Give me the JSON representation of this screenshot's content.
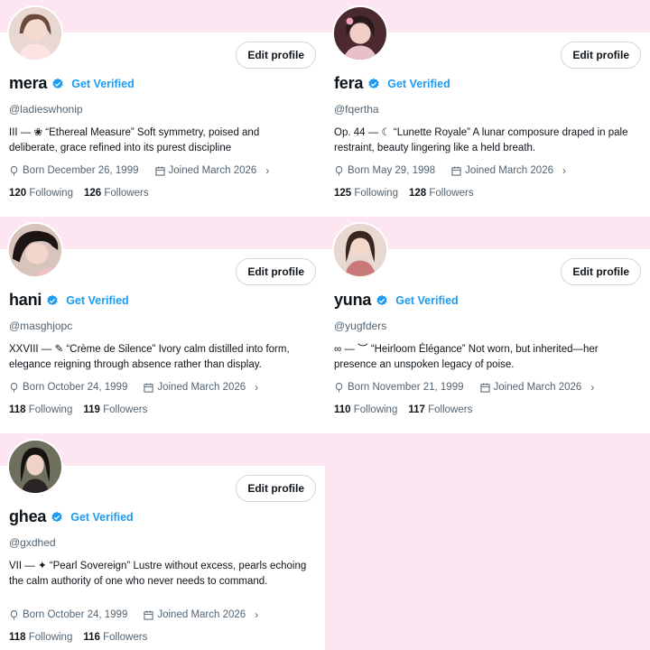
{
  "profiles": [
    {
      "name": "mera",
      "get_verified": "Get Verified",
      "handle": "@ladieswhonip",
      "bio": "III — ❀ “Ethereal Measure” Soft symmetry, poised and deliberate, grace refined into its purest discipline",
      "born": "Born December 26, 1999",
      "joined": "Joined March 2026",
      "following_count": "120",
      "following_label": "Following",
      "followers_count": "126",
      "followers_label": "Followers",
      "edit_label": "Edit profile"
    },
    {
      "name": "fera",
      "get_verified": "Get Verified",
      "handle": "@fqertha",
      "bio": "Op. 44 — ☾ “Lunette Royale” A lunar composure draped in pale restraint, beauty lingering like a held breath.",
      "born": "Born May 29, 1998",
      "joined": "Joined March 2026",
      "following_count": "125",
      "following_label": "Following",
      "followers_count": "128",
      "followers_label": "Followers",
      "edit_label": "Edit profile"
    },
    {
      "name": "hani",
      "get_verified": "Get Verified",
      "handle": "@masghjopc",
      "bio": "XXVIII — ✎ “Crème de Silence” Ivory calm distilled into form, elegance reigning through absence rather than display.",
      "born": "Born October 24, 1999",
      "joined": "Joined March 2026",
      "following_count": "118",
      "following_label": "Following",
      "followers_count": "119",
      "followers_label": "Followers",
      "edit_label": "Edit profile"
    },
    {
      "name": "yuna",
      "get_verified": "Get Verified",
      "handle": "@yugfders",
      "bio": "∞ — ︶ “Heirloom Élégance” Not worn, but inherited—her presence an unspoken legacy of poise.",
      "born": "Born November 21, 1999",
      "joined": "Joined March 2026",
      "following_count": "110",
      "following_label": "Following",
      "followers_count": "117",
      "followers_label": "Followers",
      "edit_label": "Edit profile"
    },
    {
      "name": "ghea",
      "get_verified": "Get Verified",
      "handle": "@gxdhed",
      "bio": "VII — ✦ “Pearl Sovereign” Lustre without excess, pearls echoing the calm authority of one who never needs to command.",
      "born": "Born October 24, 1999",
      "joined": "Joined March 2026",
      "following_count": "118",
      "following_label": "Following",
      "followers_count": "116",
      "followers_label": "Followers",
      "edit_label": "Edit profile"
    }
  ],
  "icons": {
    "verified": "verified-badge-icon",
    "born": "balloon-icon",
    "joined": "calendar-icon",
    "more": "chevron-right-icon"
  },
  "colors": {
    "background": "#fde6f1",
    "accent": "#1d9bf0",
    "muted": "#536471"
  }
}
